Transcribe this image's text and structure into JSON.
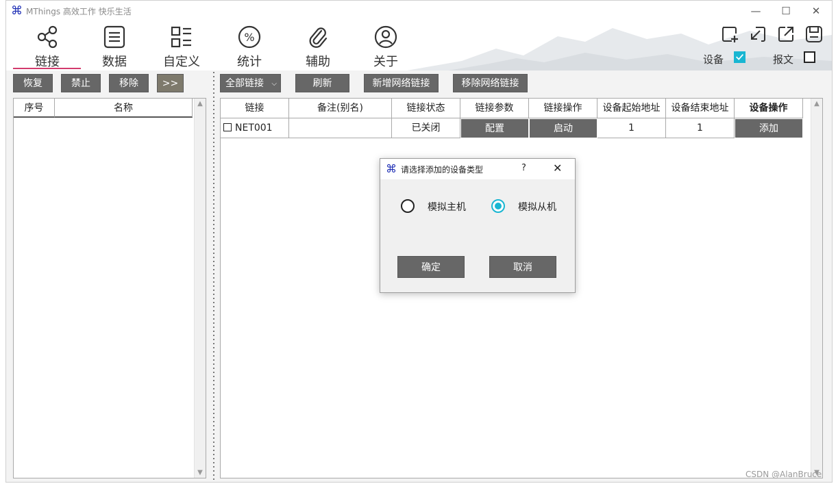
{
  "window": {
    "title": "MThings 高效工作 快乐生活",
    "controls": {
      "minimize": "—",
      "maximize": "☐",
      "close": "✕"
    }
  },
  "nav": {
    "tabs": [
      {
        "label": "链接",
        "icon": "share-icon",
        "active": true
      },
      {
        "label": "数据",
        "icon": "list-doc-icon"
      },
      {
        "label": "自定义",
        "icon": "custom-layout-icon"
      },
      {
        "label": "统计",
        "icon": "percent-icon"
      },
      {
        "label": "辅助",
        "icon": "paperclip-icon"
      },
      {
        "label": "关于",
        "icon": "user-icon"
      }
    ],
    "active_color": "#d23b6d"
  },
  "header_tools": {
    "device_label": "设备",
    "device_checked": true,
    "message_label": "报文",
    "message_checked": false
  },
  "left_toolbar": {
    "restore": "恢复",
    "disable": "禁止",
    "remove": "移除",
    "expand": ">>"
  },
  "main_toolbar": {
    "filter": "全部链接",
    "refresh": "刷新",
    "add_network": "新增网络链接",
    "remove_network": "移除网络链接"
  },
  "left_list": {
    "columns": [
      "序号",
      "名称"
    ]
  },
  "link_table": {
    "columns": [
      "链接",
      "备注(别名)",
      "链接状态",
      "链接参数",
      "链接操作",
      "设备起始地址",
      "设备结束地址",
      "设备操作"
    ],
    "rows": [
      {
        "link": "NET001",
        "alias": "",
        "status": "已关闭",
        "params": "配置",
        "operation": "启动",
        "start_addr": "1",
        "end_addr": "1",
        "device_op": "添加"
      }
    ]
  },
  "dialog": {
    "title": "请选择添加的设备类型",
    "help": "?",
    "close": "✕",
    "options": [
      {
        "label": "模拟主机",
        "selected": false
      },
      {
        "label": "模拟从机",
        "selected": true
      }
    ],
    "ok": "确定",
    "cancel": "取消"
  },
  "watermark": "CSDN @AlanBruce",
  "colors": {
    "button_bg": "#676767",
    "accent": "#19b6d2",
    "app_icon": "#1f2fb5"
  }
}
